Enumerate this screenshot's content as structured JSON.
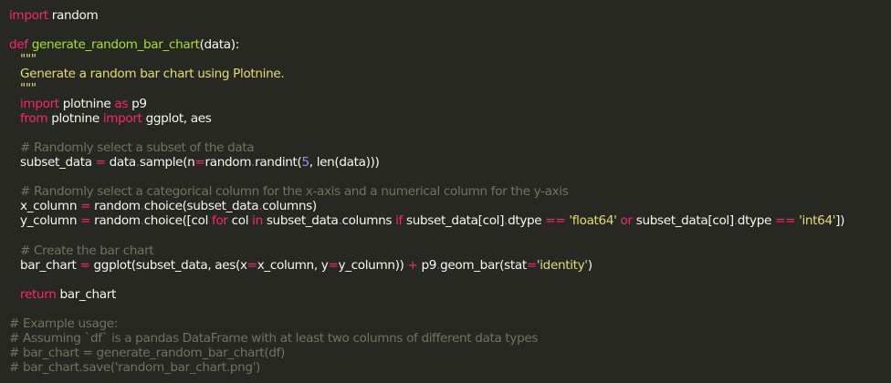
{
  "code": {
    "l1": {
      "kw": "import",
      "rest": " random"
    },
    "l3": {
      "kw": "def",
      "fn": "generate_random_bar_chart",
      "rest": "(data):"
    },
    "l4": {
      "str": "\"\"\""
    },
    "l5": {
      "str": "Generate a random bar chart using Plotnine."
    },
    "l6": {
      "str": "\"\"\""
    },
    "l7": {
      "kw1": "import",
      "mid": " plotnine ",
      "kw2": "as",
      "rest": " p9"
    },
    "l8": {
      "kw1": "from",
      "mid": " plotnine ",
      "kw2": "import",
      "rest": " ggplot, aes"
    },
    "l10": {
      "cm": "# Randomly select a subset of the data"
    },
    "l11": {
      "a": "subset_data ",
      "op1": "=",
      "b": " data",
      "dot1": ".",
      "c": "sample(n",
      "op2": "=",
      "d": "random",
      "dot2": ".",
      "e": "randint(",
      "num": "5",
      "f": ", len(data)))"
    },
    "l13": {
      "cm": "# Randomly select a categorical column for the x-axis and a numerical column for the y-axis"
    },
    "l14": {
      "a": "x_column ",
      "op": "=",
      "b": " random",
      "dot1": ".",
      "c": "choice(subset_data",
      "dot2": ".",
      "d": "columns)"
    },
    "l15": {
      "a": "y_column ",
      "op1": "=",
      "b": " random",
      "dot1": ".",
      "c": "choice([col ",
      "kw1": "for",
      "d": " col ",
      "kw2": "in",
      "e": " subset_data",
      "dot2": ".",
      "f": "columns ",
      "kw3": "if",
      "g": " subset_data[col]",
      "dot3": ".",
      "h": "dtype ",
      "op2": "==",
      "i": " ",
      "str1": "'float64'",
      "j": " ",
      "kw4": "or",
      "k": " subset_data[col]",
      "dot4": ".",
      "l": "dtype ",
      "op3": "==",
      "m": " ",
      "str2": "'int64'",
      "n": "])"
    },
    "l17": {
      "cm": "# Create the bar chart"
    },
    "l18": {
      "a": "bar_chart ",
      "op1": "=",
      "b": " ggplot(subset_data, aes(x",
      "op2": "=",
      "c": "x_column, y",
      "op3": "=",
      "d": "y_column)) ",
      "op4": "+",
      "e": " p9",
      "dot": ".",
      "f": "geom_bar(stat",
      "op5": "=",
      "str": "'identity'",
      "g": ")"
    },
    "l20": {
      "kw": "return",
      "rest": " bar_chart"
    },
    "l22": {
      "cm": "# Example usage:"
    },
    "l23": {
      "cm": "# Assuming `df` is a pandas DataFrame with at least two columns of different data types"
    },
    "l24": {
      "cm": "# bar_chart = generate_random_bar_chart(df)"
    },
    "l25": {
      "cm": "# bar_chart.save('random_bar_chart.png')"
    }
  }
}
